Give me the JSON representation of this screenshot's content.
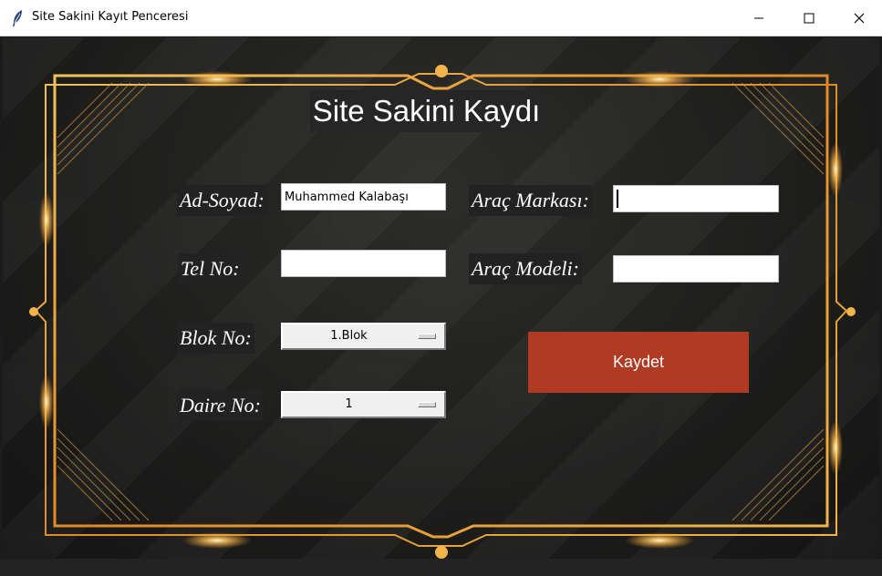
{
  "window": {
    "title": "Site Sakini Kayıt Penceresi",
    "icon": "feather-icon",
    "controls": [
      "minimize-icon",
      "maximize-icon",
      "close-icon"
    ]
  },
  "form": {
    "heading": "Site Sakini Kaydı",
    "fields": {
      "name": {
        "label": "Ad-Soyad:",
        "value": "Muhammed Kalabaşı"
      },
      "phone": {
        "label": "Tel No:",
        "value": ""
      },
      "block": {
        "label": "Blok No:",
        "selected": "1.Blok"
      },
      "apartment": {
        "label": "Daire No:",
        "selected": "1"
      },
      "car_brand": {
        "label": "Araç Markası:",
        "value": ""
      },
      "car_model": {
        "label": "Araç Modeli:",
        "value": ""
      }
    },
    "save_button": "Kaydet"
  },
  "colors": {
    "frame_gold": "#e8a035",
    "save_button": "#b03a22",
    "label_bg": "#222222"
  }
}
